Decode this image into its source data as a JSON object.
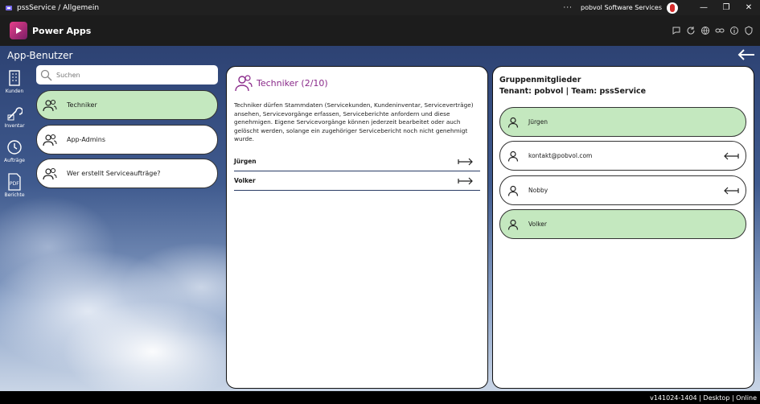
{
  "window": {
    "title": "pssService / Allgemein",
    "more": "···",
    "user": "pobvol Software Services",
    "minimize": "—",
    "maximize": "❐",
    "close": "✕"
  },
  "header": {
    "app_name": "Power Apps"
  },
  "page": {
    "title": "App-Benutzer"
  },
  "nav": {
    "items": [
      {
        "label": "Kunden",
        "icon": "building-icon"
      },
      {
        "label": "Inventar",
        "icon": "wrench-icon"
      },
      {
        "label": "Aufträge",
        "icon": "clock-icon"
      },
      {
        "label": "Berichte",
        "icon": "pdf-icon"
      }
    ]
  },
  "search": {
    "placeholder": "Suchen",
    "value": ""
  },
  "roles": [
    {
      "label": "Techniker",
      "active": true
    },
    {
      "label": "App-Admins",
      "active": false
    },
    {
      "label": "Wer erstellt Serviceaufträge?",
      "active": false
    }
  ],
  "detail": {
    "title": "Techniker (2/10)",
    "description": "Techniker dürfen Stammdaten (Servicekunden, Kundeninventar, Serviceverträge) ansehen, Servicevorgänge erfassen, Serviceberichte anfordern und diese genehmigen. Eigene Servicevorgänge können jederzeit bearbeitet oder auch gelöscht werden, solange ein zugehöriger Servicebericht noch nicht genehmigt wurde.",
    "members": [
      "Jürgen",
      "Volker"
    ]
  },
  "group": {
    "title": "Gruppenmitglieder",
    "subtitle": "Tenant: pobvol | Team: pssService",
    "members": [
      {
        "label": "Jürgen",
        "in_role": true
      },
      {
        "label": "kontakt@pobvol.com",
        "in_role": false
      },
      {
        "label": "Nobby",
        "in_role": false
      },
      {
        "label": "Volker",
        "in_role": true
      }
    ]
  },
  "status": {
    "text": "v141024-1404 | Desktop | Online"
  },
  "colors": {
    "accent": "#8a2a8a",
    "active_bg": "#c4e8bf",
    "header_bg": "#1c1c1c"
  }
}
